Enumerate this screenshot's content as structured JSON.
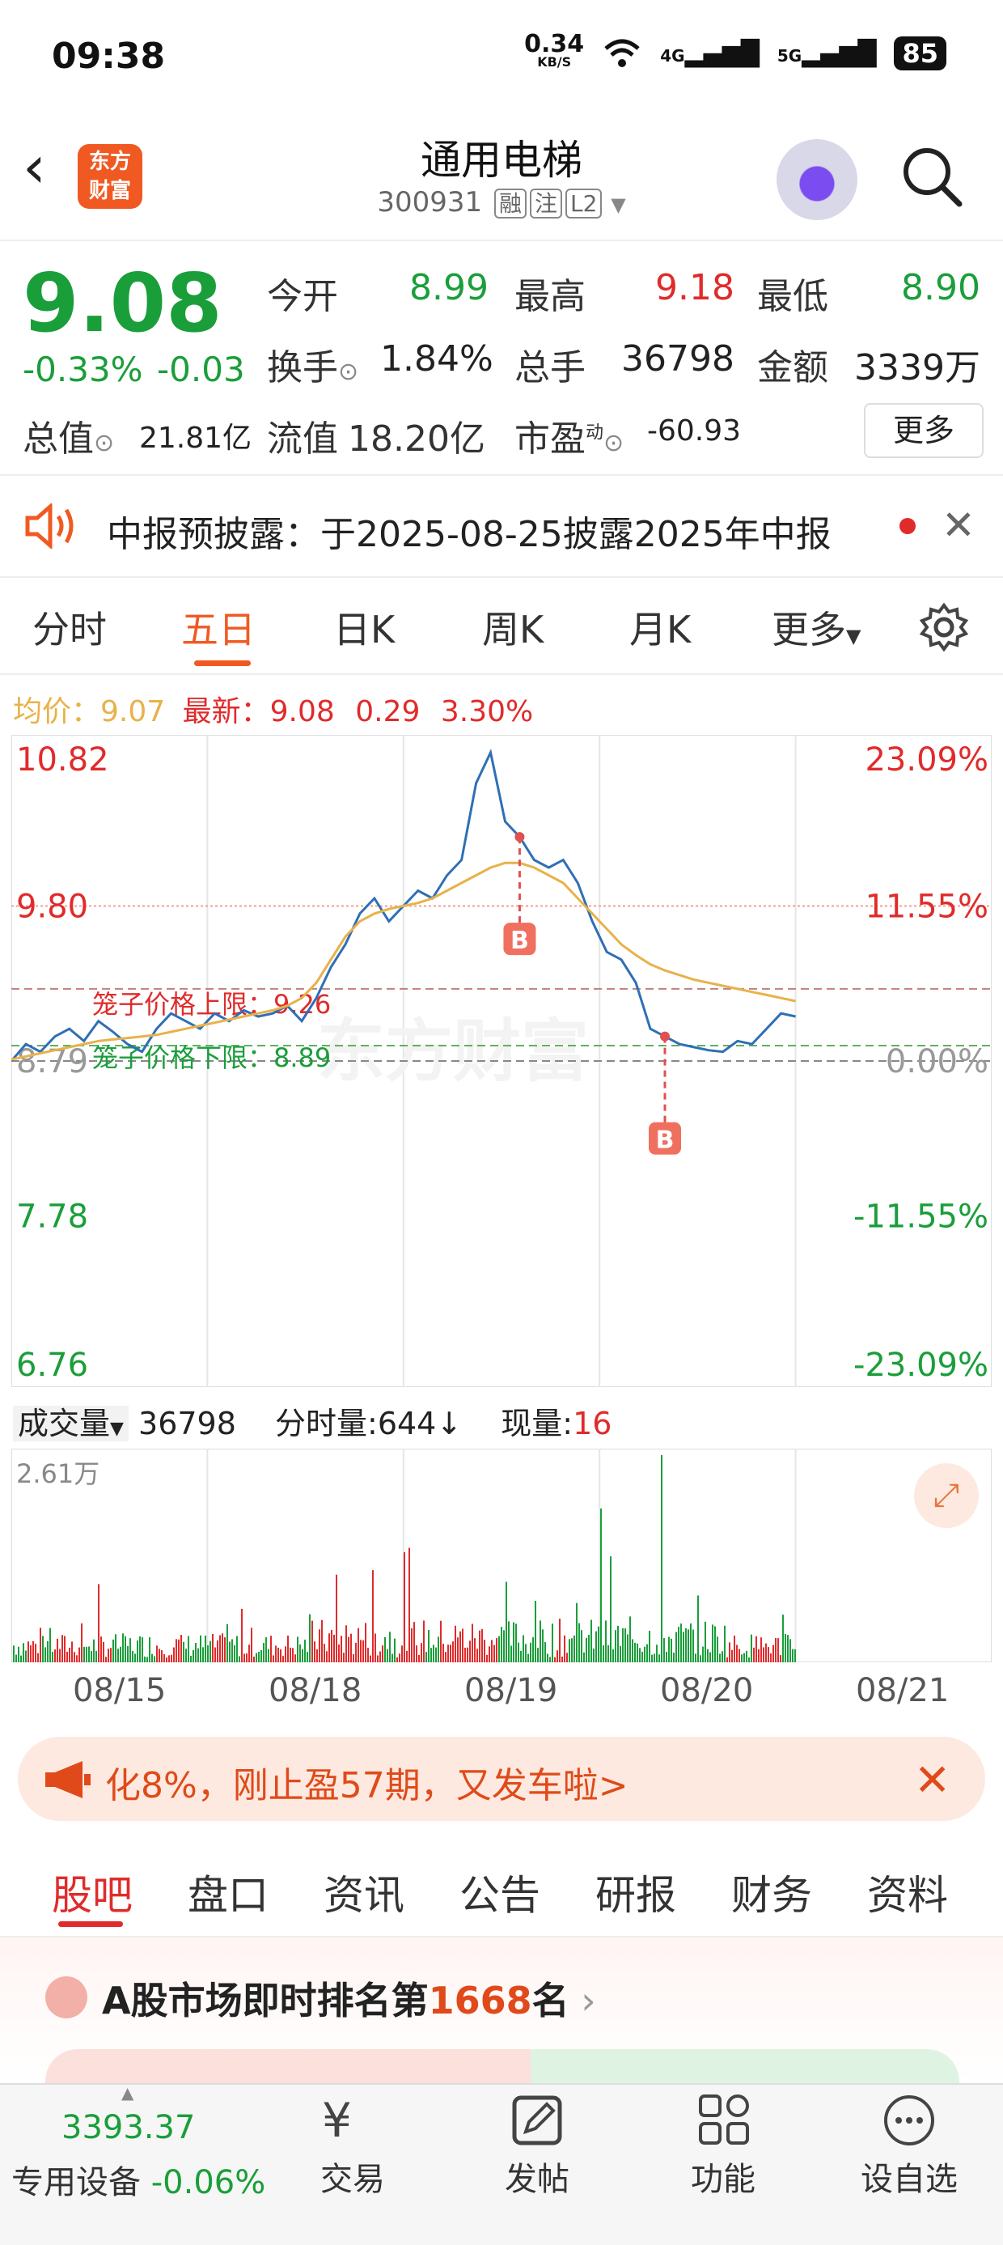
{
  "status": {
    "time": "09:38",
    "speed": "0.34",
    "speed_unit": "KB/S",
    "net1": "4G",
    "net2": "5G",
    "battery": "85"
  },
  "header": {
    "logo_line1": "东方",
    "logo_line2": "财富",
    "stock_name": "通用电梯",
    "stock_code": "300931",
    "tags": [
      "融",
      "注",
      "L2"
    ]
  },
  "quote": {
    "price": "9.08",
    "change_pct": "-0.33%",
    "change": "-0.03",
    "open_label": "今开",
    "open": "8.99",
    "high_label": "最高",
    "high": "9.18",
    "low_label": "最低",
    "low": "8.90",
    "turnover_label": "换手",
    "turnover": "1.84%",
    "volume_label": "总手",
    "volume": "36798",
    "amount_label": "金额",
    "amount": "3339万",
    "mktcap_label": "总值",
    "mktcap": "21.81亿",
    "float_label": "流值",
    "float": "18.20亿",
    "pe_label": "市盈",
    "pe_sup": "动",
    "pe": "-60.93",
    "more": "更多"
  },
  "notice": {
    "text": "中报预披露：于2025-08-25披露2025年中报"
  },
  "tabs": [
    "分时",
    "五日",
    "日K",
    "周K",
    "月K",
    "更多"
  ],
  "active_tab": 1,
  "legend": {
    "avg_label": "均价：",
    "avg": "9.07",
    "latest_label": "最新：",
    "latest": "9.08",
    "chg": "0.29",
    "pct": "3.30%"
  },
  "chart_data": {
    "type": "line",
    "y_left_ticks": [
      "10.82",
      "9.80",
      "8.79",
      "7.78",
      "6.76"
    ],
    "y_right_ticks": [
      "23.09%",
      "11.55%",
      "0.00%",
      "-11.55%",
      "-23.09%"
    ],
    "ylim": [
      6.76,
      10.82
    ],
    "x_labels": [
      "08/15",
      "08/18",
      "08/19",
      "08/20",
      "08/21"
    ],
    "upper_label": "笼子价格上限：9.26",
    "lower_label": "笼子价格下限：8.89",
    "upper": 9.26,
    "lower": 8.89,
    "base": 8.79,
    "markers": [
      "B",
      "B"
    ],
    "watermark": "东方财富",
    "series": [
      {
        "name": "price",
        "values": [
          8.79,
          8.9,
          8.85,
          8.95,
          9.0,
          8.92,
          9.05,
          8.98,
          8.9,
          8.85,
          9.0,
          9.1,
          9.05,
          9.0,
          9.1,
          9.05,
          9.12,
          9.08,
          9.1,
          9.15,
          9.05,
          9.2,
          9.4,
          9.55,
          9.75,
          9.85,
          9.7,
          9.8,
          9.9,
          9.85,
          10.0,
          10.1,
          10.6,
          10.8,
          10.35,
          10.25,
          10.1,
          10.05,
          10.1,
          9.95,
          9.7,
          9.5,
          9.45,
          9.3,
          9.0,
          8.95,
          8.9,
          8.88,
          8.86,
          8.85,
          8.92,
          8.9,
          9.0,
          9.1,
          9.08
        ]
      },
      {
        "name": "avg",
        "values": [
          8.8,
          8.82,
          8.84,
          8.86,
          8.88,
          8.9,
          8.92,
          8.93,
          8.94,
          8.95,
          8.96,
          8.98,
          9.0,
          9.02,
          9.04,
          9.06,
          9.08,
          9.1,
          9.12,
          9.15,
          9.2,
          9.3,
          9.45,
          9.6,
          9.7,
          9.75,
          9.78,
          9.8,
          9.82,
          9.85,
          9.9,
          9.95,
          10.0,
          10.05,
          10.08,
          10.08,
          10.05,
          10.0,
          9.95,
          9.85,
          9.75,
          9.65,
          9.55,
          9.48,
          9.42,
          9.38,
          9.35,
          9.32,
          9.3,
          9.28,
          9.26,
          9.24,
          9.22,
          9.2,
          9.18
        ]
      }
    ]
  },
  "volume": {
    "label": "成交量",
    "total": "36798",
    "tick_label": "分时量:644",
    "arrow": "↓",
    "now_label": "现量:",
    "now": "16",
    "max": "2.61万"
  },
  "banner": {
    "text": "化8%，刚止盈57期，又发车啦>"
  },
  "subtabs": [
    "股吧",
    "盘口",
    "资讯",
    "公告",
    "研报",
    "财务",
    "资料"
  ],
  "rank": {
    "prefix": "A股市场即时排名第",
    "num": "1668",
    "suffix": "名"
  },
  "bottom": {
    "index_value": "3393.37",
    "index_name": "专用设备",
    "index_chg": "-0.06%",
    "items": [
      "交易",
      "发帖",
      "功能",
      "设自选"
    ]
  }
}
